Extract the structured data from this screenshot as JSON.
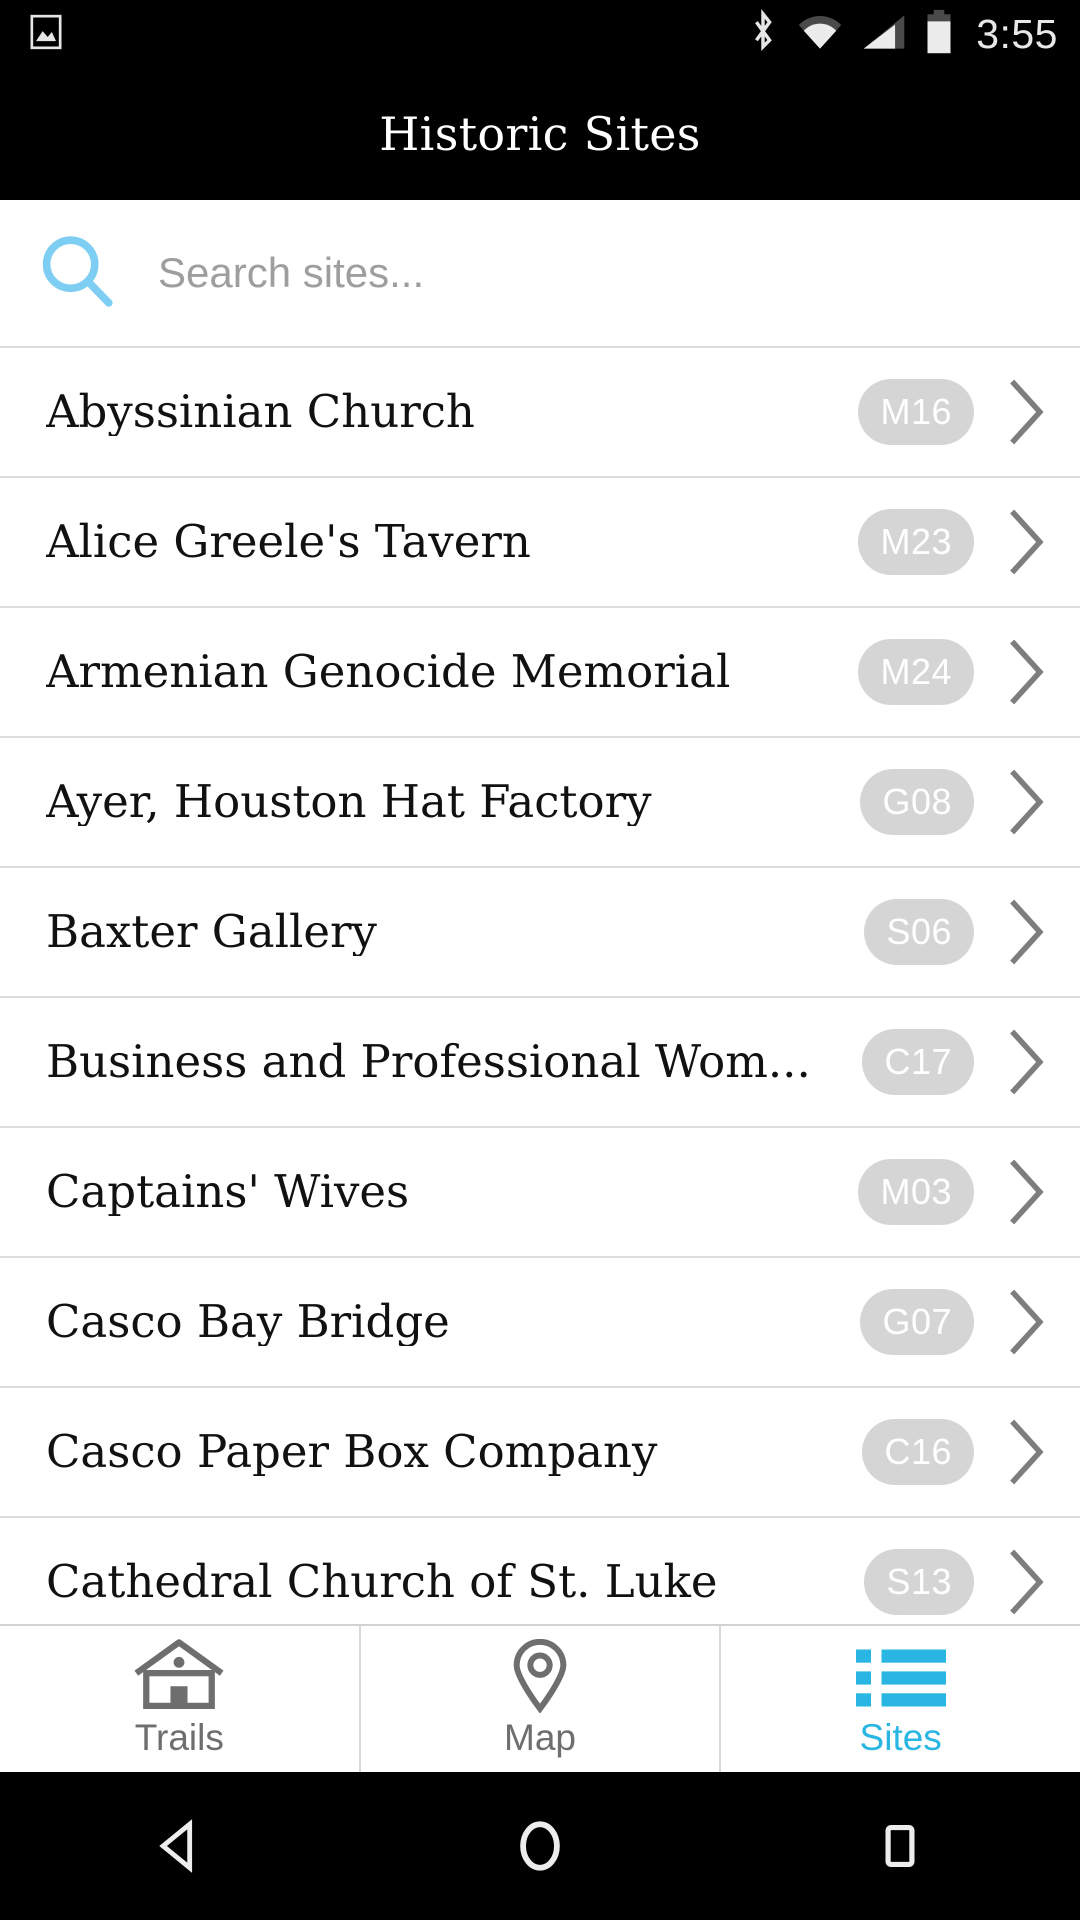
{
  "status_bar": {
    "notification_icon": "image-icon",
    "bluetooth_icon": "bluetooth-icon",
    "wifi_icon": "wifi-icon",
    "cellular_icon": "cellular-signal-icon",
    "battery_icon": "battery-icon",
    "time": "3:55"
  },
  "header": {
    "title": "Historic Sites"
  },
  "search": {
    "icon": "search-icon",
    "placeholder": "Search sites...",
    "value": ""
  },
  "list": {
    "rows": [
      {
        "title": "Abyssinian Church",
        "badge": "M16"
      },
      {
        "title": "Alice Greele's Tavern",
        "badge": "M23"
      },
      {
        "title": "Armenian Genocide Memorial",
        "badge": "M24"
      },
      {
        "title": "Ayer, Houston Hat Factory",
        "badge": "G08"
      },
      {
        "title": "Baxter Gallery",
        "badge": "S06"
      },
      {
        "title": "Business and Professional Wom...",
        "badge": "C17"
      },
      {
        "title": "Captains' Wives",
        "badge": "M03"
      },
      {
        "title": "Casco Bay Bridge",
        "badge": "G07"
      },
      {
        "title": "Casco Paper Box Company",
        "badge": "C16"
      },
      {
        "title": "Cathedral Church of St. Luke",
        "badge": "S13"
      }
    ]
  },
  "tabs": [
    {
      "label": "Trails",
      "icon": "house-icon",
      "active": false
    },
    {
      "label": "Map",
      "icon": "map-pin-icon",
      "active": false
    },
    {
      "label": "Sites",
      "icon": "list-icon",
      "active": true
    }
  ],
  "nav_bar": {
    "back": "back-triangle-icon",
    "home": "home-circle-icon",
    "recents": "recents-square-icon"
  },
  "colors": {
    "accent": "#29b6e3",
    "search_icon": "#7ecef4",
    "badge_bg": "#d5d5d5",
    "badge_text": "#ffffff",
    "chevron": "#7d7d7d",
    "divider": "#dcdcdc",
    "title_bar_bg": "#000000",
    "tab_inactive": "#6e6e6e"
  }
}
